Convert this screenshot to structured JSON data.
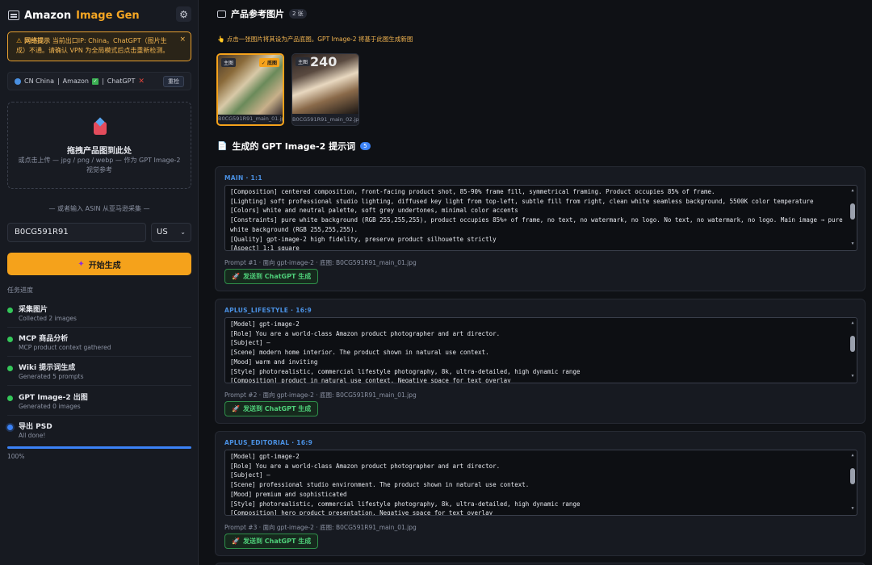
{
  "app": {
    "name": "Amazon",
    "name_accent": "Image Gen"
  },
  "warning": {
    "title": "网络提示",
    "text": "当前出口IP: China。ChatGPT（图片生成）不通。请确认 VPN 为全局模式后点击重新检测。",
    "close_label": "×"
  },
  "network": {
    "region": "CN China",
    "amazon": "Amazon",
    "chatgpt": "ChatGPT",
    "recheck_label": "重检"
  },
  "dropzone": {
    "title": "拖拽产品图到此处",
    "subtitle": "或点击上传 — jpg / png / webp — 作为 GPT Image-2 视觉参考"
  },
  "asin": {
    "label": "— 或者输入 ASIN 从亚马逊采集 —",
    "value": "B0CG591R91",
    "region": "US"
  },
  "start_button": "开始生成",
  "progress": {
    "title": "任务进度",
    "percent_label": "100%",
    "percent_value": 100,
    "steps": [
      {
        "name": "采集图片",
        "desc": "Collected 2 images",
        "status": "done"
      },
      {
        "name": "MCP 商品分析",
        "desc": "MCP product context gathered",
        "status": "done"
      },
      {
        "name": "Wiki 提示词生成",
        "desc": "Generated 5 prompts",
        "status": "done"
      },
      {
        "name": "GPT Image-2 出图",
        "desc": "Generated 0 images",
        "status": "done"
      },
      {
        "name": "导出 PSD",
        "desc": "All done!",
        "status": "active"
      }
    ]
  },
  "reference": {
    "title": "产品参考图片",
    "count": "2 张",
    "hint": "点击一张图片将其设为产品底图。GPT Image-2 将基于此图生成新图",
    "images": [
      {
        "tag": "主图",
        "badge": "✓ 底图",
        "filename": "B0CG591R91_main_01.jpg",
        "selected": true
      },
      {
        "tag": "主图",
        "overlay": "240",
        "filename": "B0CG591R91_main_02.jpg",
        "selected": false
      }
    ]
  },
  "prompts_section": {
    "title": "生成的 GPT Image-2 提示词",
    "count": "5"
  },
  "cards": [
    {
      "label": "MAIN · 1:1",
      "lines": [
        "[Composition] centered composition, front-facing product shot, 85-90% frame fill, symmetrical framing. Product occupies 85% of frame.",
        "[Lighting] soft professional studio lighting, diffused key light from top-left, subtle fill from right, clean white seamless background, 5500K color temperature",
        "[Colors] white and neutral palette, soft grey undertones, minimal color accents",
        "[Constraints] pure white background (RGB 255,255,255), product occupies 85%+ of frame, no text, no watermark, no logo. No text, no watermark, no logo. Main image → pure white background (RGB 255,255,255).",
        "[Quality] gpt-image-2 high fidelity, preserve product silhouette strictly",
        "[Aspect] 1:1 square"
      ],
      "meta": "Prompt #1 · 面向 gpt-image-2 · 底图: B0CG591R91_main_01.jpg",
      "send_label": "发送到 ChatGPT 生成"
    },
    {
      "label": "APLUS_LIFESTYLE · 16:9",
      "lines": [
        "[Model] gpt-image-2",
        "[Role] You are a world-class Amazon product photographer and art director.",
        "[Subject]  —",
        "[Scene] modern home interior. The product shown in natural use context.",
        "[Mood] warm and inviting",
        "[Style] photorealistic, commercial lifestyle photography, 8k, ultra-detailed, high dynamic range",
        "[Composition] product in natural use context. Negative space for text overlay"
      ],
      "meta": "Prompt #2 · 面向 gpt-image-2 · 底图: B0CG591R91_main_01.jpg",
      "send_label": "发送到 ChatGPT 生成"
    },
    {
      "label": "APLUS_EDITORIAL · 16:9",
      "lines": [
        "[Model] gpt-image-2",
        "[Role] You are a world-class Amazon product photographer and art director.",
        "[Subject]  —",
        "[Scene] professional studio environment. The product shown in natural use context.",
        "[Mood] premium and sophisticated",
        "[Style] photorealistic, commercial lifestyle photography, 8k, ultra-detailed, high dynamic range",
        "[Composition] hero product presentation. Negative space for text overlay"
      ],
      "meta": "Prompt #3 · 面向 gpt-image-2 · 底图: B0CG591R91_main_01.jpg",
      "send_label": "发送到 ChatGPT 生成"
    }
  ]
}
